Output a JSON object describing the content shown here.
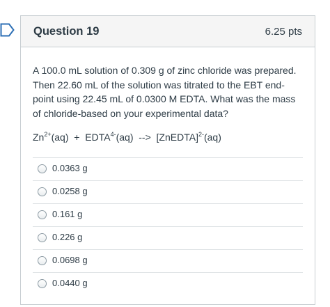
{
  "question": {
    "title": "Question 19",
    "points": "6.25 pts",
    "text": "A 100.0 mL solution of 0.309 g of zinc chloride was prepared. Then 22.60 mL of the solution was titrated to the EBT end-point using 22.45 mL of 0.0300 M EDTA.  What was the mass of chloride-based on your experimental data?",
    "equation": {
      "zn": "Zn",
      "zn_charge": "2+",
      "zn_state": "(aq)",
      "plus": "  +  ",
      "edta": "EDTA",
      "edta_charge": "4-",
      "edta_state": "(aq)",
      "arrow": "  -->  ",
      "complex": "[ZnEDTA]",
      "complex_charge": "2-",
      "complex_state": "(aq)"
    }
  },
  "answers": [
    {
      "label": "0.0363 g"
    },
    {
      "label": "0.0258 g"
    },
    {
      "label": "0.161 g"
    },
    {
      "label": "0.226 g"
    },
    {
      "label": "0.0698 g"
    },
    {
      "label": "0.0440 g"
    }
  ],
  "colors": {
    "flag_outline": "#2d6fb5",
    "border": "#c7cdd1",
    "header_bg": "#f5f5f5",
    "text": "#2d3b45"
  },
  "icons": {
    "flag": "bookmark-flag-icon",
    "radio": "radio-unselected-icon"
  }
}
